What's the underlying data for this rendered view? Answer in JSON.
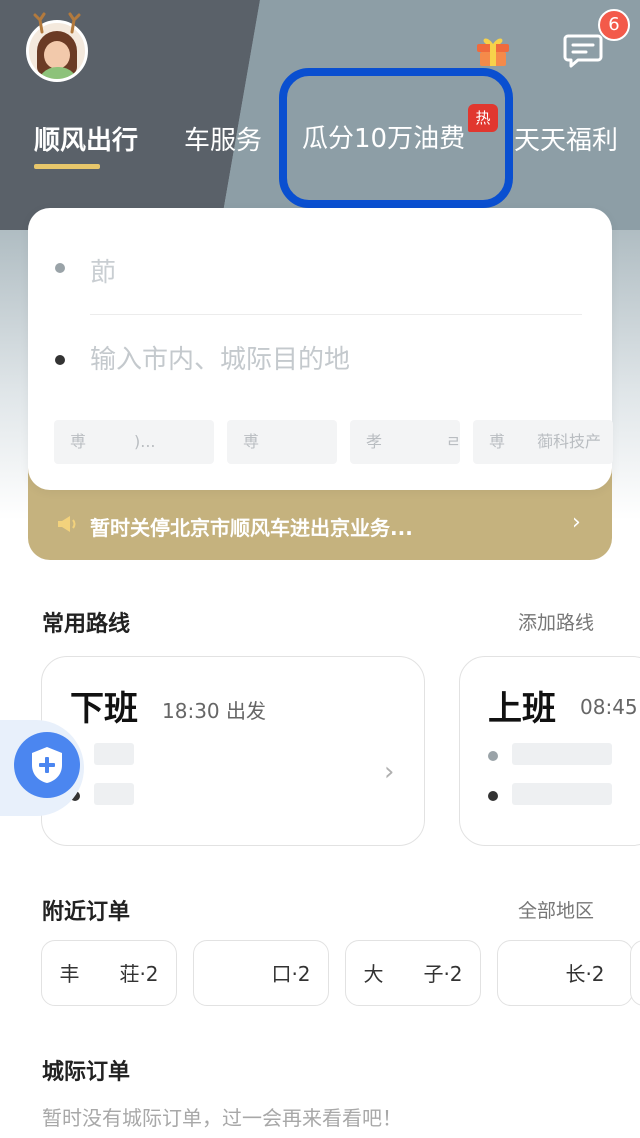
{
  "header": {
    "badge_count": "6",
    "tabs": [
      {
        "label": "顺风出行",
        "active": true
      },
      {
        "label": "车服务",
        "active": false
      },
      {
        "label": "瓜分10万油费",
        "active": false,
        "badge": "热"
      },
      {
        "label": "天天福利",
        "active": false
      }
    ]
  },
  "trip": {
    "start_text": "莭",
    "destination_placeholder": "输入市内、城际目的地",
    "quick_chips": [
      "尃　　　)...",
      "尃",
      "孝　　　　ㄹ",
      "尃　　蓹科技产"
    ]
  },
  "notice": {
    "text": "暂时关停北京市顺风车进出京业务...",
    "chevron": "›"
  },
  "routes": {
    "title": "常用路线",
    "link": "添加路线",
    "items": [
      {
        "name": "下班",
        "time": "18:30 出发"
      },
      {
        "name": "上班",
        "time": "08:45"
      }
    ]
  },
  "nearby": {
    "title": "附近订单",
    "link": "全部地区",
    "chips": [
      "丰　　荘·2",
      "　　　口·2",
      "大　　子·2",
      "　　长·2"
    ]
  },
  "intercity": {
    "title": "城际订单",
    "empty": "暂时没有城际订单，过一会再来看看吧！"
  },
  "colors": {
    "accent_gold": "#e8c76b",
    "notice_bg": "#c5b27e",
    "highlight_blue": "#0a4fd0",
    "hot_red": "#e1372f",
    "badge_red": "#f35a4a"
  }
}
